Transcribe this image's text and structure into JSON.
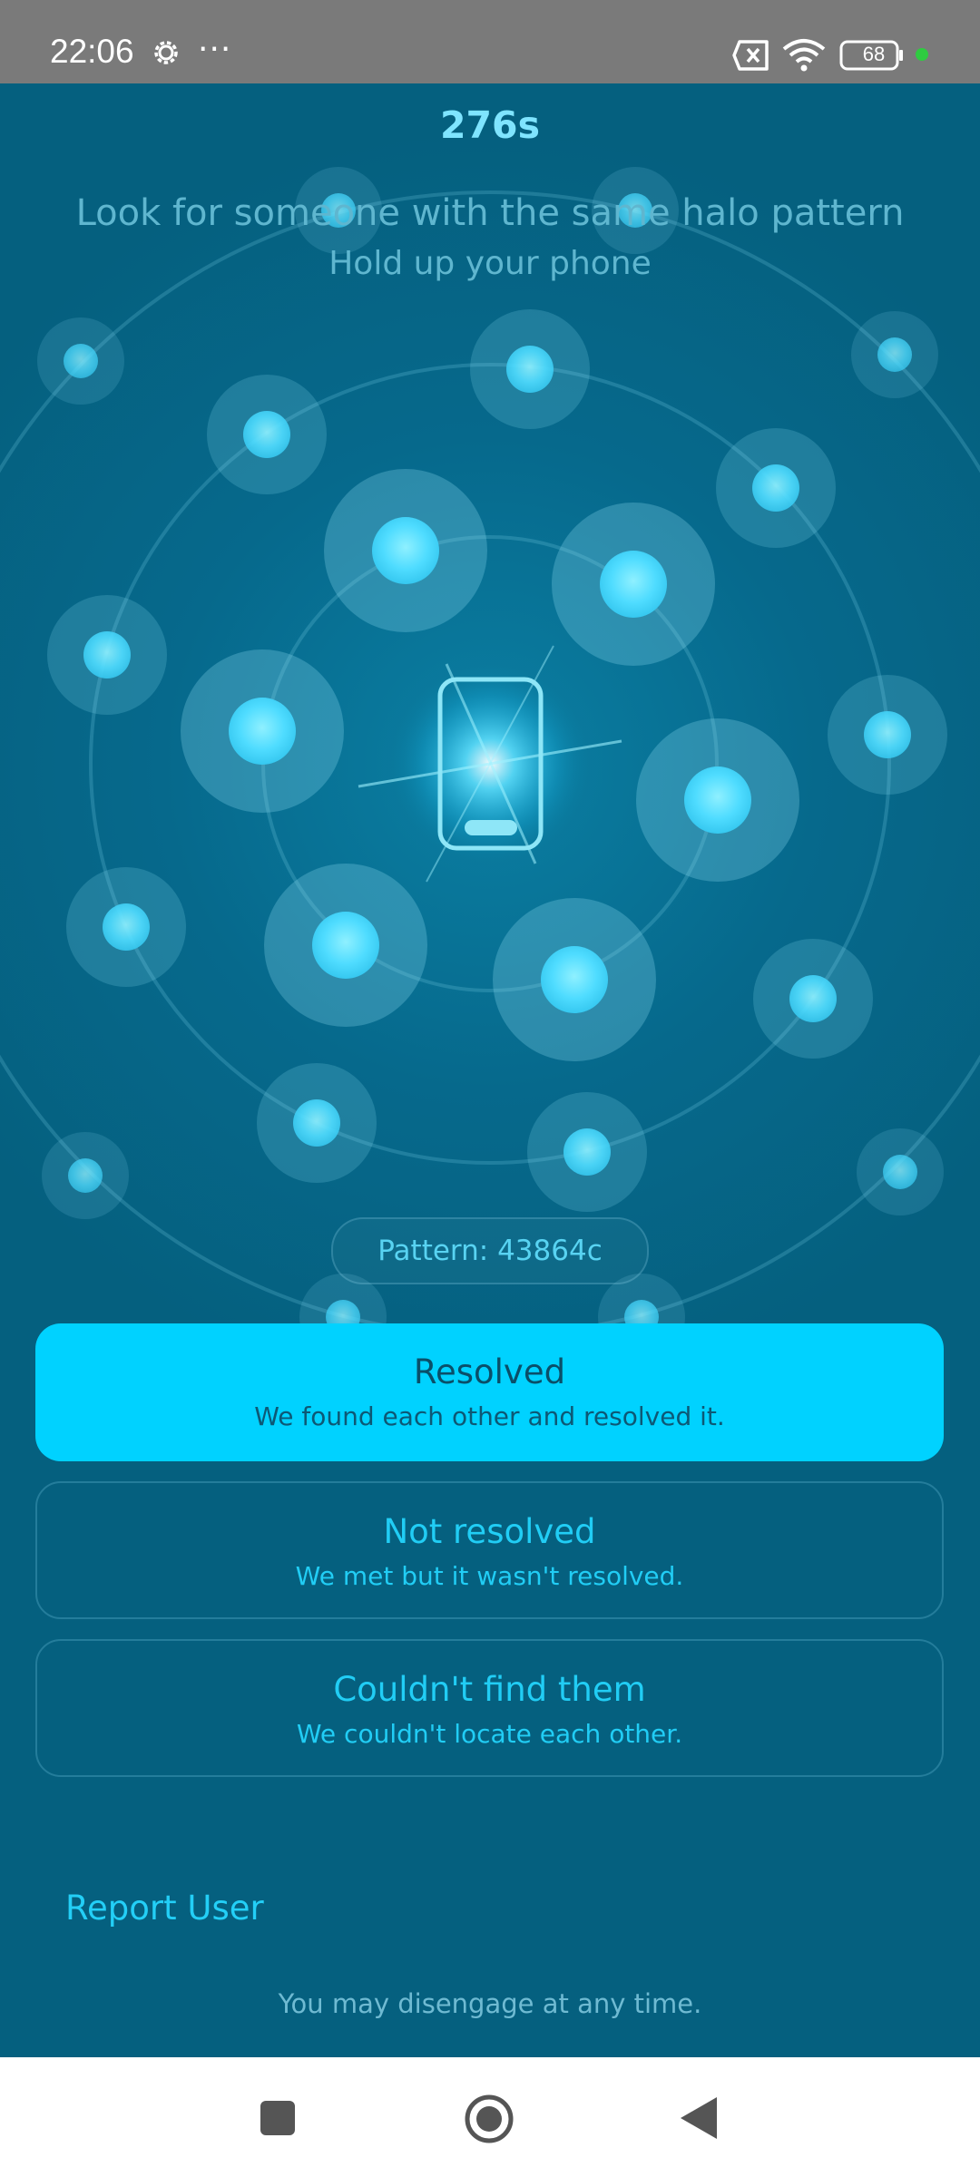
{
  "status_bar": {
    "time": "22:06",
    "overflow": "···",
    "battery": "68",
    "icons": [
      "gear-icon",
      "sim-error-icon",
      "wifi-icon",
      "battery-icon",
      "privacy-dot-icon"
    ]
  },
  "screen": {
    "timer": "276s",
    "headline": "Look for someone with the same halo pattern",
    "subhead": "Hold up your phone",
    "pattern_label": "Pattern: 43864c",
    "center_icon": "phone-icon"
  },
  "options": {
    "resolved": {
      "title": "Resolved",
      "subtitle": "We found each other and resolved it."
    },
    "not_resolved": {
      "title": "Not resolved",
      "subtitle": "We met but it wasn't resolved."
    },
    "not_found": {
      "title": "Couldn't find them",
      "subtitle": "We couldn't locate each other."
    }
  },
  "report_label": "Report User",
  "footer": "You may disengage at any time.",
  "nav_bar": {
    "icons": [
      "recents-square-icon",
      "home-circle-icon",
      "back-triangle-icon"
    ]
  },
  "colors": {
    "background": "#05607f",
    "accent": "#00d2ff",
    "status_bar": "#7a7a7a",
    "green_dot": "#2ecc40"
  }
}
